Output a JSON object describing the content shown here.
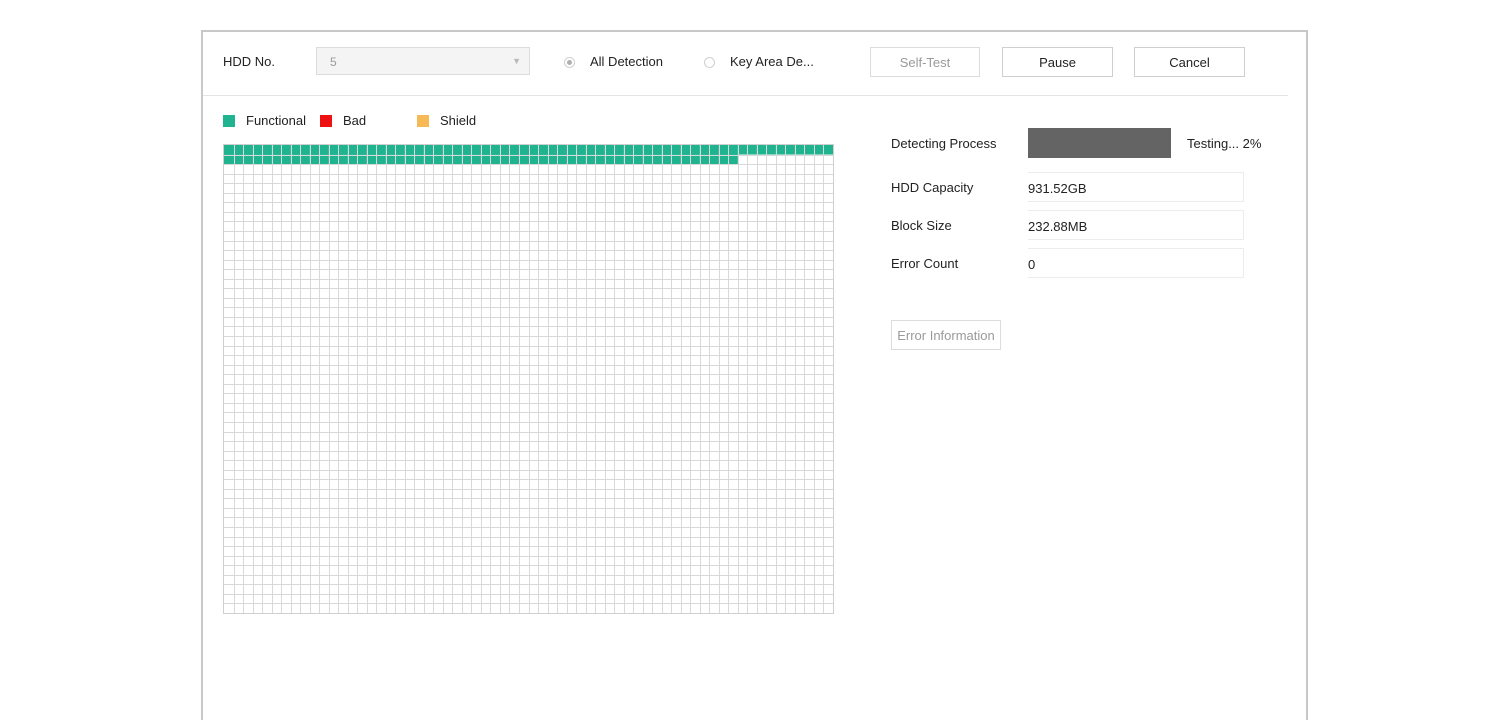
{
  "toolbar": {
    "hdd_no_label": "HDD No.",
    "hdd_no_value": "5",
    "all_detection_label": "All Detection",
    "key_area_label": "Key Area De...",
    "self_test_label": "Self-Test",
    "pause_label": "Pause",
    "cancel_label": "Cancel"
  },
  "legend": {
    "functional": {
      "label": "Functional",
      "color": "#1fb38f"
    },
    "bad": {
      "label": "Bad",
      "color": "#ee1111"
    },
    "shield": {
      "label": "Shield",
      "color": "#f7b955"
    }
  },
  "block_grid": {
    "columns": 64,
    "rows": 49,
    "functional_blocks": 118,
    "grid_line_color": "#d8d8d8",
    "functional_color": "#1fb38f"
  },
  "info": {
    "detecting_process_label": "Detecting Process",
    "progress_fraction": 1.0,
    "progress_color": "#646464",
    "progress_text": "Testing... 2%",
    "hdd_capacity_label": "HDD Capacity",
    "hdd_capacity_value": "931.52GB",
    "block_size_label": "Block Size",
    "block_size_value": "232.88MB",
    "error_count_label": "Error Count",
    "error_count_value": "0",
    "error_info_label": "Error Information"
  }
}
